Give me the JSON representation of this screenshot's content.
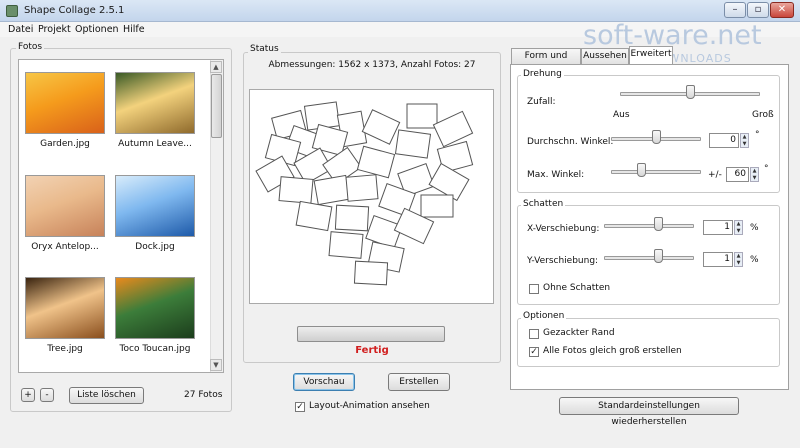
{
  "window": {
    "title": "Shape Collage 2.5.1",
    "minimize": "–",
    "maximize": "▫",
    "close": "✕"
  },
  "menu": [
    "Datei",
    "Projekt",
    "Optionen",
    "Hilfe"
  ],
  "watermark": {
    "main": "soft-ware.net",
    "sub": "AKTUELLE DOWNLOADS"
  },
  "fotos": {
    "title": "Fotos",
    "items": [
      {
        "label": "Garden.jpg",
        "colors": [
          "#f59b1c",
          "#d9611a",
          "#f7c646"
        ]
      },
      {
        "label": "Autumn Leave...",
        "colors": [
          "#f3d27d",
          "#8f6a2c",
          "#3a5a26"
        ]
      },
      {
        "label": "Oryx Antelop...",
        "colors": [
          "#e9b98b",
          "#c7825a",
          "#f2d2b3"
        ]
      },
      {
        "label": "Dock.jpg",
        "colors": [
          "#7fb8ef",
          "#1e5aa9",
          "#d8ecfb"
        ]
      },
      {
        "label": "Tree.jpg",
        "colors": [
          "#f0c38a",
          "#8a4f1e",
          "#3a2410"
        ]
      },
      {
        "label": "Toco Toucan.jpg",
        "colors": [
          "#3c7d3a",
          "#1c3d1c",
          "#e98a1d"
        ]
      }
    ],
    "add_label": "+",
    "remove_label": "-",
    "clear_label": "Liste löschen",
    "count": "27 Fotos"
  },
  "status": {
    "title": "Status",
    "dimensions": "Abmessungen: 1562 x 1373, Anzahl Fotos: 27",
    "progress_fraction": 1.0,
    "state": "Fertig"
  },
  "actions": {
    "preview": "Vorschau",
    "create": "Erstellen",
    "layout_animation": "Layout-Animation ansehen",
    "layout_animation_checked": true
  },
  "tabs": [
    "Form und Größe",
    "Aussehen",
    "Erweitert"
  ],
  "drehung": {
    "title": "Drehung",
    "zufall_label": "Zufall:",
    "aus": "Aus",
    "gross": "Groß",
    "zufall_level": 0.5,
    "avg_angle_label": "Durchschn. Winkel:",
    "avg_angle_value": "0",
    "avg_angle_unit": "°",
    "avg_angle_level": 0.5,
    "max_angle_label": "Max. Winkel:",
    "max_angle_prefix": "+/-",
    "max_angle_value": "60",
    "max_angle_unit": "°",
    "max_angle_level": 0.33
  },
  "schatten": {
    "title": "Schatten",
    "x_label": "X-Verschiebung:",
    "x_value": "1",
    "x_unit": "%",
    "x_level": 0.6,
    "y_label": "Y-Verschiebung:",
    "y_value": "1",
    "y_unit": "%",
    "y_level": 0.6,
    "none_label": "Ohne Schatten",
    "none_checked": false
  },
  "optionen": {
    "title": "Optionen",
    "jagged_label": "Gezackter Rand",
    "jagged_checked": false,
    "same_size_label": "Alle Fotos gleich groß erstellen",
    "same_size_checked": true
  },
  "reset_label": "Standardeinstellungen wiederherstellen"
}
